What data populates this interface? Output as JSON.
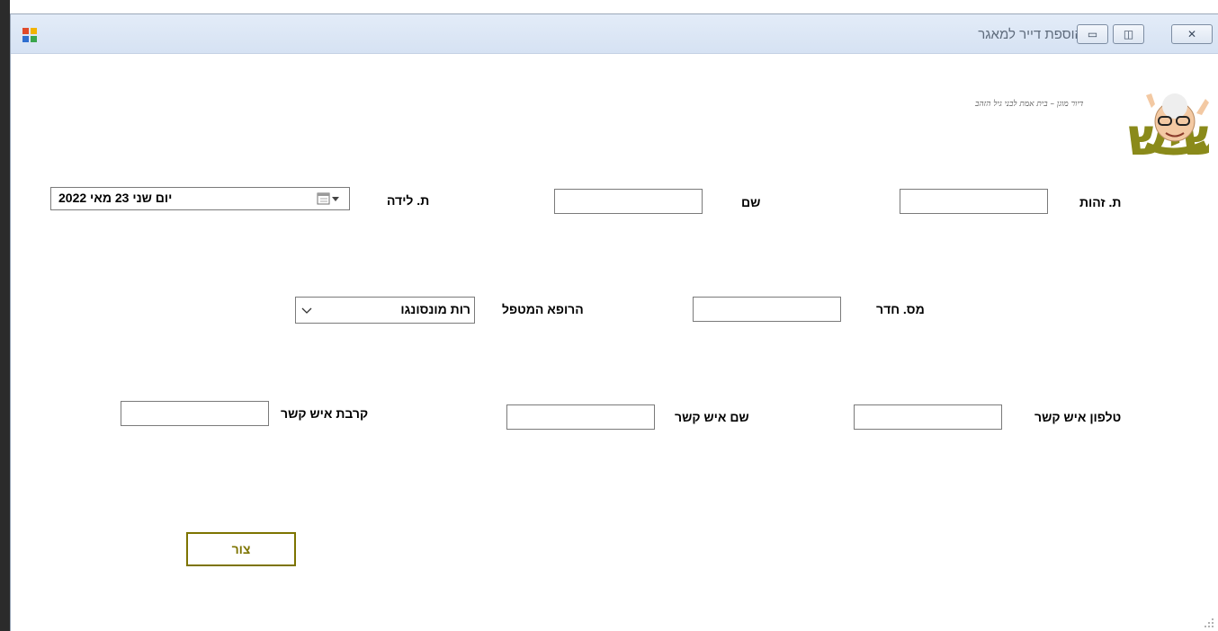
{
  "window": {
    "title": "הוספת דייר למאגר",
    "min_glyph": "▭",
    "max_glyph": "◫",
    "close_glyph": "✕"
  },
  "logo": {
    "brand_text": "הקשיש",
    "tagline": "דיור מוגן – בית אמת לבני גיל הזהב",
    "brand_color": "#8a8a1a"
  },
  "form": {
    "id_label": "ת. זהות",
    "id_value": "",
    "name_label": "שם",
    "name_value": "",
    "birth_label": "ת. לידה",
    "birth_value": "יום שני   23   מאי   2022",
    "room_label": "מס. חדר",
    "room_value": "",
    "doctor_label": "הרופא המטפל",
    "doctor_value": "רות מונסונגו",
    "contact_phone_label": "טלפון איש קשר",
    "contact_phone_value": "",
    "contact_name_label": "שם איש קשר",
    "contact_name_value": "",
    "contact_relation_label": "קרבת איש קשר",
    "contact_relation_value": ""
  },
  "actions": {
    "create_label": "צור"
  },
  "colors": {
    "accent": "#7d7400",
    "titlebar": "#dbe6f4"
  }
}
